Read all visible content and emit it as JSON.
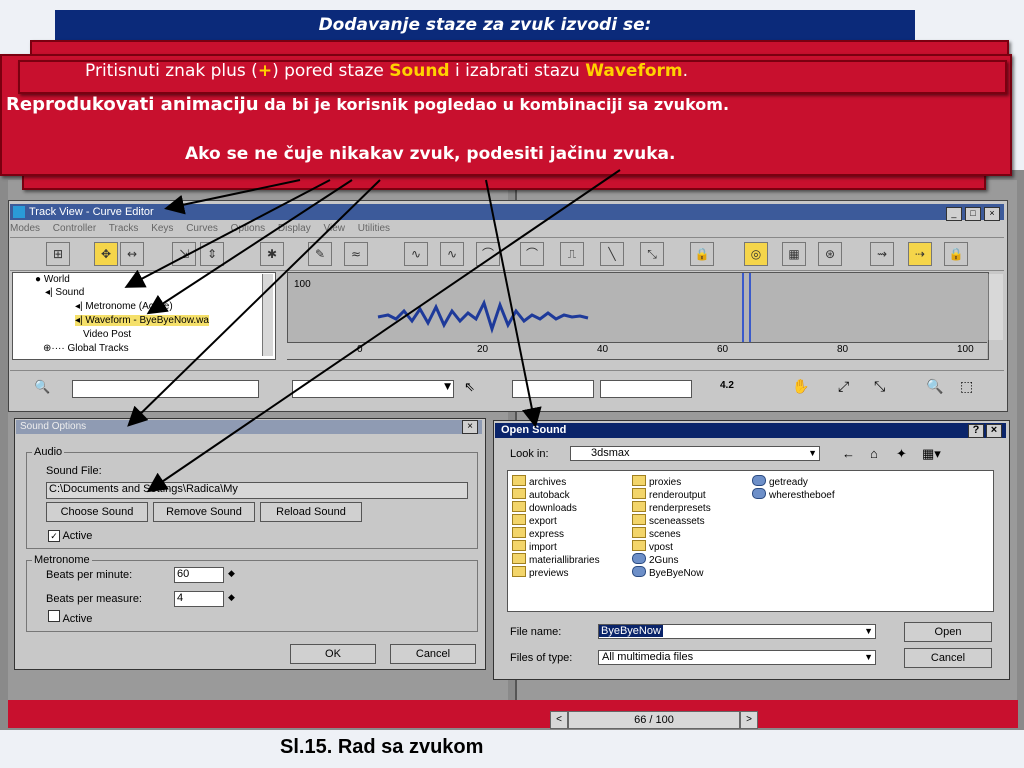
{
  "header": {
    "title": "Dodavanje staze za zvuk izvodi se:"
  },
  "messages": {
    "line1_a": "Pritisnuti znak plus (",
    "line1_plus": "+",
    "line1_b": ") pored staze ",
    "line1_sound": "Sound",
    "line1_c": " i izabrati stazu ",
    "line1_waveform": "Waveform",
    "line1_d": ".",
    "line2_a": "Reprodukovati animaciju",
    "line2_b": " da bi je korisnik pogledao u kombinaciji sa zvukom.",
    "line3": "Ako se ne čuje nikakav zvuk, podesiti jačinu zvuka."
  },
  "track_view": {
    "title": "Track View - Curve Editor",
    "menu": [
      "Modes",
      "Controller",
      "Tracks",
      "Keys",
      "Curves",
      "Options",
      "Display",
      "View",
      "Utilities"
    ],
    "tree": [
      "World",
      "Sound",
      "Metronome (Active)",
      "Waveform - ByeByeNow.wa",
      "Video Post",
      "Global Tracks"
    ],
    "graph_label": "100",
    "ruler": [
      "0",
      "20",
      "40",
      "60",
      "80",
      "100"
    ],
    "zoom_value": "4.2"
  },
  "sound_options": {
    "title": "Sound Options",
    "audio_group": "Audio",
    "sound_file_label": "Sound File:",
    "sound_file_path": "C:\\Documents and Settings\\Radica\\My",
    "choose_button": "Choose Sound",
    "remove_button": "Remove Sound",
    "reload_button": "Reload Sound",
    "active_label": "Active",
    "metronome_group": "Metronome",
    "bpm_label": "Beats per minute:",
    "bpm_value": "60",
    "bpmeasure_label": "Beats per measure:",
    "bpmeasure_value": "4",
    "metronome_active_label": "Active",
    "ok_button": "OK",
    "cancel_button": "Cancel"
  },
  "open_sound": {
    "title": "Open Sound",
    "look_in_label": "Look in:",
    "look_in_value": "3dsmax",
    "files": [
      {
        "name": "archives",
        "type": "folder"
      },
      {
        "name": "autoback",
        "type": "folder"
      },
      {
        "name": "downloads",
        "type": "folder"
      },
      {
        "name": "export",
        "type": "folder"
      },
      {
        "name": "express",
        "type": "folder"
      },
      {
        "name": "import",
        "type": "folder"
      },
      {
        "name": "materiallibraries",
        "type": "folder"
      },
      {
        "name": "previews",
        "type": "folder"
      },
      {
        "name": "proxies",
        "type": "folder"
      },
      {
        "name": "renderoutput",
        "type": "folder"
      },
      {
        "name": "renderpresets",
        "type": "folder"
      },
      {
        "name": "sceneassets",
        "type": "folder"
      },
      {
        "name": "scenes",
        "type": "folder"
      },
      {
        "name": "vpost",
        "type": "folder"
      },
      {
        "name": "2Guns",
        "type": "media"
      },
      {
        "name": "ByeByeNow",
        "type": "media"
      },
      {
        "name": "getready",
        "type": "media"
      },
      {
        "name": "wherestheboef",
        "type": "media"
      }
    ],
    "file_name_label": "File name:",
    "file_name_value": "ByeByeNow",
    "file_type_label": "Files of type:",
    "file_type_value": "All multimedia files",
    "open_button": "Open",
    "cancel_button": "Cancel"
  },
  "time_slider": {
    "value": "66 / 100"
  },
  "caption": "Sl.15. Rad sa zvukom",
  "colors": {
    "header_bg": "#0b2a7a",
    "callout_red": "#c8102e",
    "highlight_yellow": "#ffd200"
  }
}
